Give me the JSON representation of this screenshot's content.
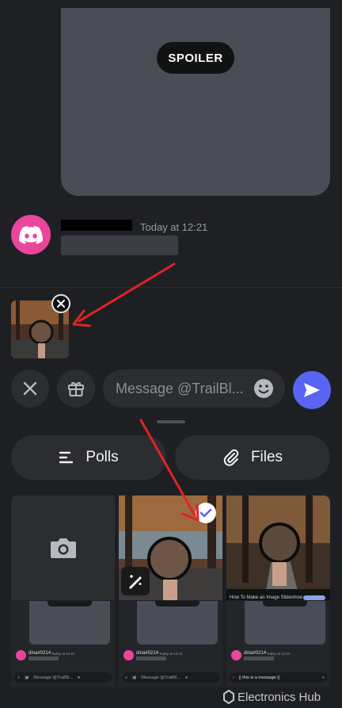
{
  "chat": {
    "spoiler_label": "SPOILER",
    "message": {
      "timestamp": "Today at 12:21"
    }
  },
  "composer": {
    "placeholder": "Message @TrailBl...",
    "polls_label": "Polls",
    "files_label": "Files"
  },
  "gallery": {
    "ad_caption": "How To Make an Image Slideshow"
  },
  "thumbnails": [
    {
      "username": "dina#0214",
      "timestamp": "Today at 12:21",
      "placeholder": "Message @TrailBl..."
    },
    {
      "username": "dina#0214",
      "timestamp": "Today at 12:21",
      "placeholder": "Message @TrailBl..."
    },
    {
      "username": "dina#0214",
      "timestamp": "Today at 12:22",
      "input_text": "|| this is a message ||"
    }
  ],
  "watermark": {
    "brand": "Electronics Hub"
  },
  "colors": {
    "blurple": "#5865f2",
    "avatar_pink": "#eb459e",
    "annotation_red": "#e02424"
  }
}
